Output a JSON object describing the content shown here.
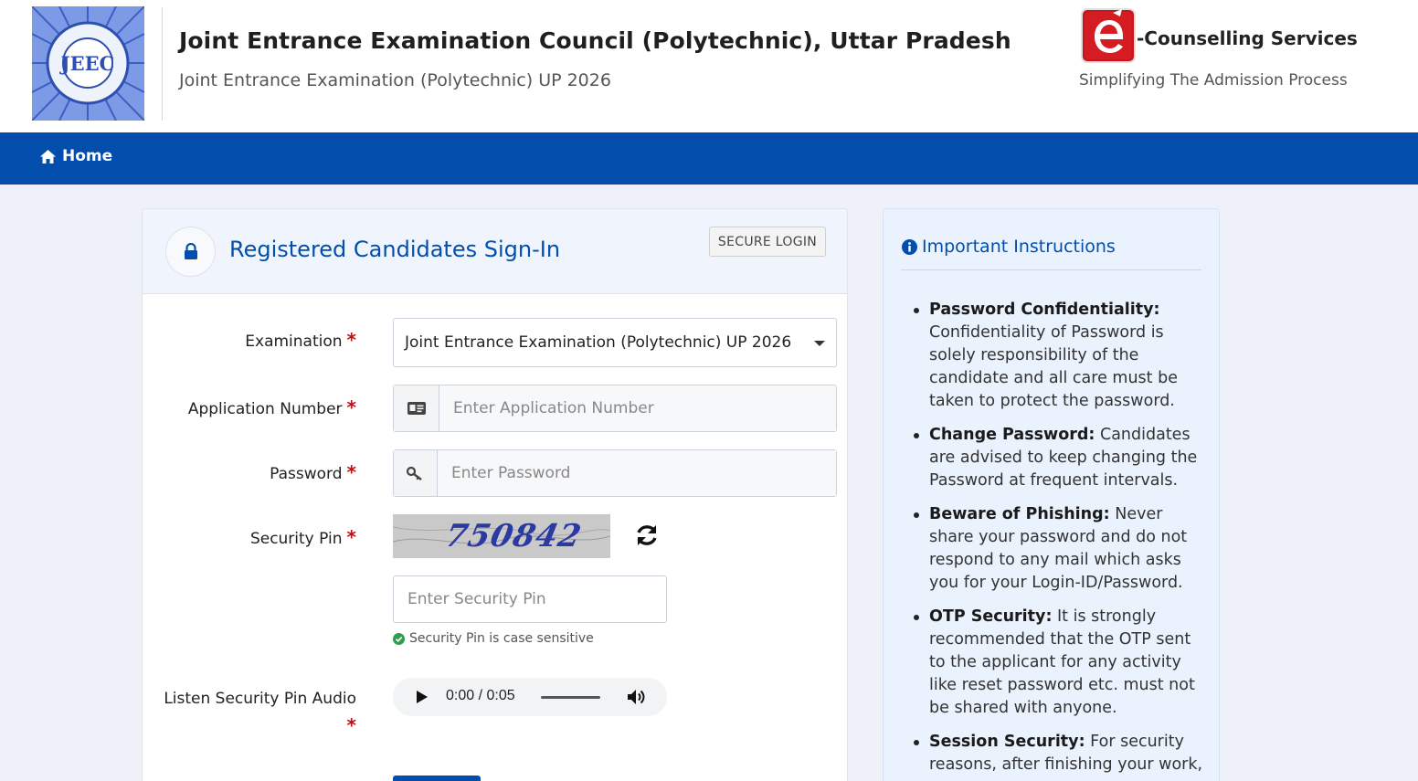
{
  "header": {
    "title": "Joint Entrance Examination Council (Polytechnic), Uttar Pradesh",
    "subtitle": "Joint Entrance Examination (Polytechnic) UP 2026",
    "logo_text": "JEEC",
    "ec_title": "-Counselling Services",
    "ec_tagline": "Simplifying The Admission Process"
  },
  "nav": {
    "home_label": "Home"
  },
  "signin": {
    "title": "Registered Candidates Sign-In",
    "badge": "SECURE LOGIN",
    "required_mark": "*",
    "examination_label": "Examination",
    "examination_value": "Joint Entrance Examination (Polytechnic) UP 2026",
    "application_label": "Application Number",
    "application_placeholder": "Enter Application Number",
    "password_label": "Password",
    "password_placeholder": "Enter Password",
    "security_pin_label": "Security Pin",
    "captcha_text": "750842",
    "pin_placeholder": "Enter Security Pin",
    "pin_note": "Security Pin is case sensitive",
    "audio_label": "Listen Security Pin Audio",
    "audio_time": "0:00 / 0:05"
  },
  "instructions": {
    "title": "Important Instructions",
    "items": [
      {
        "heading": "Password Confidentiality:",
        "text": "Confidentiality of Password is solely responsibility of the candidate and all care must be taken to protect the password."
      },
      {
        "heading": "Change Password:",
        "text": "Candidates are advised to keep changing the Password at frequent intervals."
      },
      {
        "heading": "Beware of Phishing:",
        "text": "Never share your password and do not respond to any mail which asks you for your Login-ID/Password."
      },
      {
        "heading": "OTP Security:",
        "text": "It is strongly recommended that the OTP sent to the applicant for any activity like reset password etc. must not be shared with anyone."
      },
      {
        "heading": "Session Security:",
        "text": "For security reasons, after finishing your work,"
      }
    ]
  },
  "colors": {
    "brand_blue": "#034ead",
    "required_red": "#b3151a",
    "success_green": "#2e9e4f"
  }
}
